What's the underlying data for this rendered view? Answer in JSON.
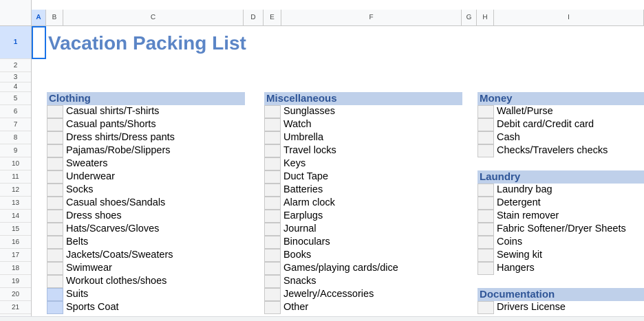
{
  "sheet": {
    "columns": [
      "A",
      "B",
      "C",
      "D",
      "E",
      "F",
      "G",
      "H",
      "I"
    ],
    "selected_column": "A",
    "rows": [
      "1",
      "2",
      "3",
      "4",
      "5",
      "6",
      "7",
      "8",
      "9",
      "10",
      "11",
      "12",
      "13",
      "14",
      "15",
      "16",
      "17",
      "18",
      "19",
      "20",
      "21"
    ],
    "selected_row": "1",
    "title": "Vacation Packing List"
  },
  "sections": {
    "clothing": {
      "title": "Clothing",
      "items": [
        {
          "label": "Casual shirts/T-shirts",
          "checked": false
        },
        {
          "label": "Casual pants/Shorts",
          "checked": false
        },
        {
          "label": "Dress shirts/Dress pants",
          "checked": false
        },
        {
          "label": "Pajamas/Robe/Slippers",
          "checked": false
        },
        {
          "label": "Sweaters",
          "checked": false
        },
        {
          "label": "Underwear",
          "checked": false
        },
        {
          "label": "Socks",
          "checked": false
        },
        {
          "label": "Casual shoes/Sandals",
          "checked": false
        },
        {
          "label": "Dress shoes",
          "checked": false
        },
        {
          "label": "Hats/Scarves/Gloves",
          "checked": false
        },
        {
          "label": "Belts",
          "checked": false
        },
        {
          "label": "Jackets/Coats/Sweaters",
          "checked": false
        },
        {
          "label": "Swimwear",
          "checked": false
        },
        {
          "label": "Workout clothes/shoes",
          "checked": false
        },
        {
          "label": "Suits",
          "checked": true
        },
        {
          "label": "Sports Coat",
          "checked": true
        }
      ]
    },
    "misc": {
      "title": "Miscellaneous",
      "items": [
        {
          "label": "Sunglasses",
          "checked": false
        },
        {
          "label": "Watch",
          "checked": false
        },
        {
          "label": "Umbrella",
          "checked": false
        },
        {
          "label": "Travel locks",
          "checked": false
        },
        {
          "label": "Keys",
          "checked": false
        },
        {
          "label": "Duct Tape",
          "checked": false
        },
        {
          "label": "Batteries",
          "checked": false
        },
        {
          "label": "Alarm clock",
          "checked": false
        },
        {
          "label": "Earplugs",
          "checked": false
        },
        {
          "label": "Journal",
          "checked": false
        },
        {
          "label": "Binoculars",
          "checked": false
        },
        {
          "label": "Books",
          "checked": false
        },
        {
          "label": "Games/playing cards/dice",
          "checked": false
        },
        {
          "label": "Snacks",
          "checked": false
        },
        {
          "label": "Jewelry/Accessories",
          "checked": false
        },
        {
          "label": "Other",
          "checked": false
        }
      ]
    },
    "money": {
      "title": "Money",
      "items": [
        {
          "label": "Wallet/Purse",
          "checked": false
        },
        {
          "label": "Debit card/Credit card",
          "checked": false
        },
        {
          "label": "Cash",
          "checked": false
        },
        {
          "label": "Checks/Travelers checks",
          "checked": false
        }
      ]
    },
    "laundry": {
      "title": "Laundry",
      "items": [
        {
          "label": "Laundry bag",
          "checked": false
        },
        {
          "label": "Detergent",
          "checked": false
        },
        {
          "label": "Stain remover",
          "checked": false
        },
        {
          "label": "Fabric Softener/Dryer Sheets",
          "checked": false
        },
        {
          "label": "Coins",
          "checked": false
        },
        {
          "label": "Sewing kit",
          "checked": false
        },
        {
          "label": "Hangers",
          "checked": false
        }
      ]
    },
    "documentation": {
      "title": "Documentation",
      "items": [
        {
          "label": "Drivers License",
          "checked": false
        }
      ]
    }
  },
  "colors": {
    "title": "#5b85c6",
    "section_header_bg": "#bfd0ea",
    "section_header_text": "#2f5597",
    "checked_box": "#c9daf8",
    "selection": "#1a73e8"
  }
}
